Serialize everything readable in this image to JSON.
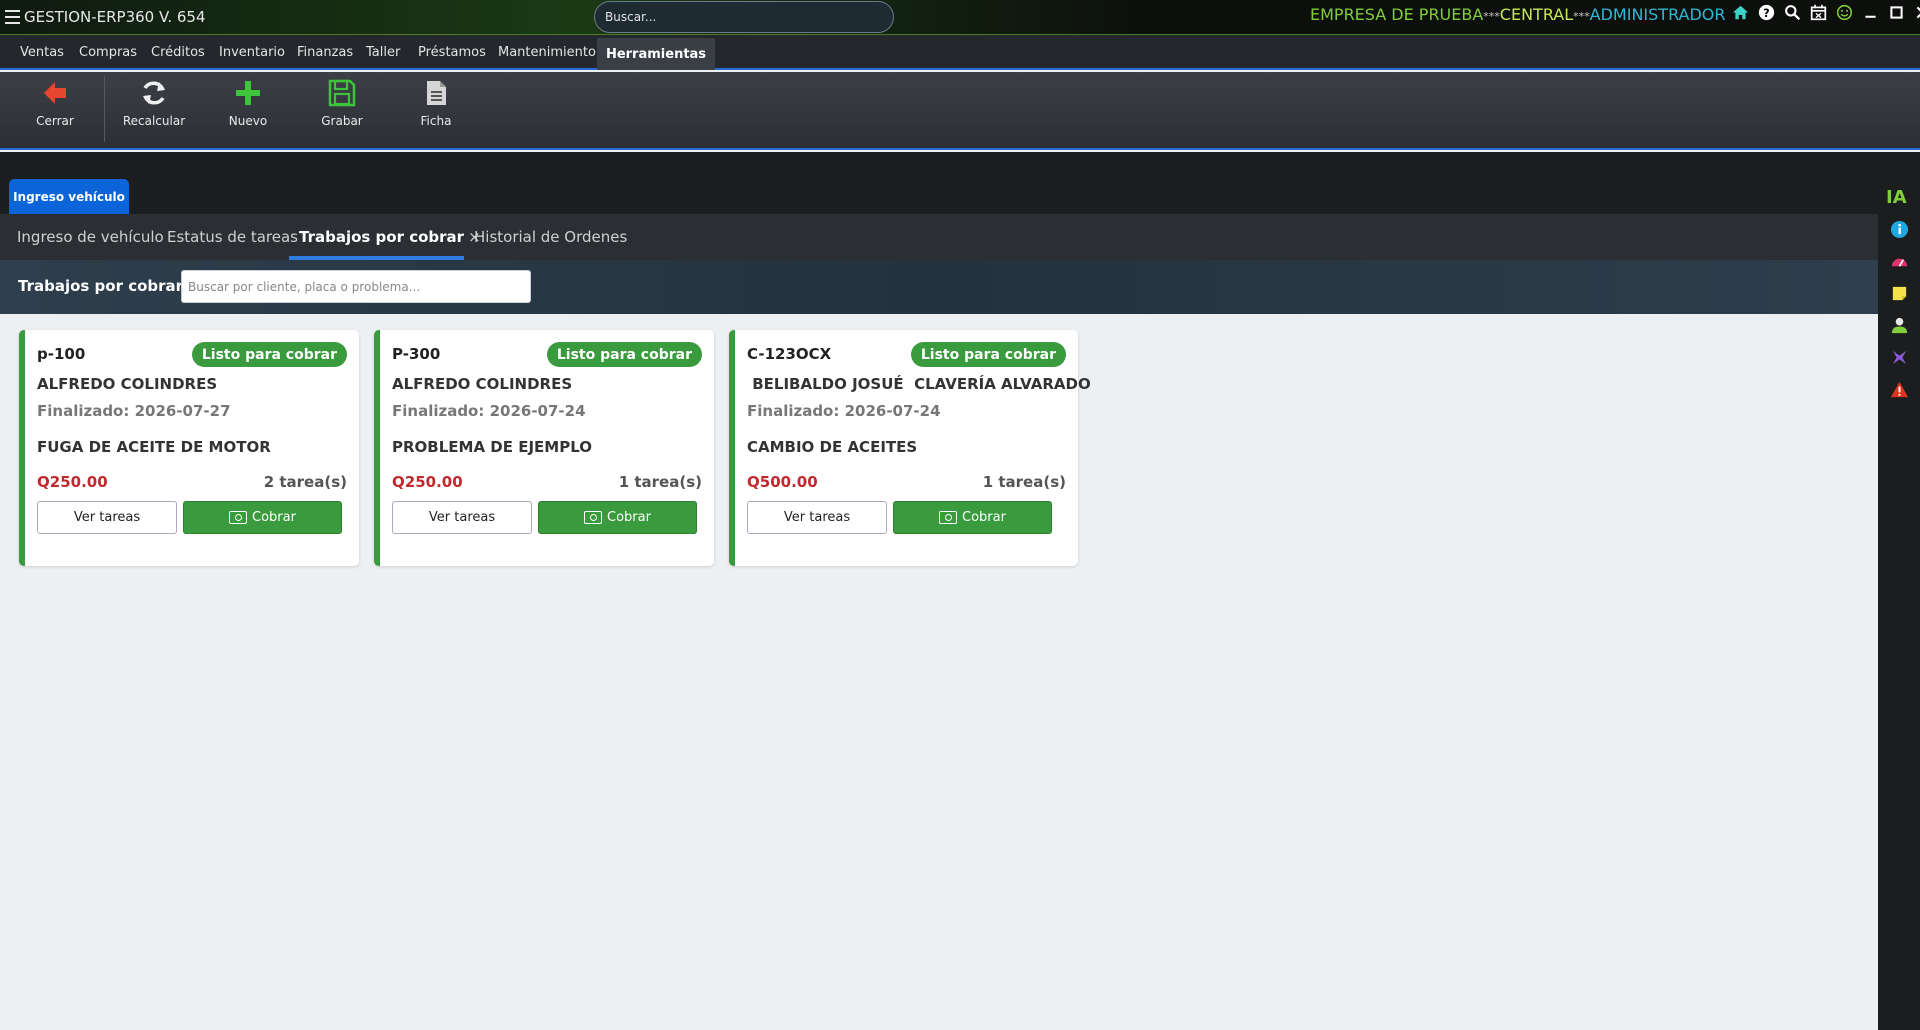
{
  "window": {
    "title": "GESTION-ERP360 V. 654",
    "search_placeholder": "Buscar...",
    "company": "EMPRESA DE PRUEBA",
    "sep": "***",
    "branch": "CENTRAL",
    "user": "ADMINISTRADOR"
  },
  "menu": {
    "items": [
      "Ventas",
      "Compras",
      "Créditos",
      "Inventario",
      "Finanzas",
      "Taller",
      "Préstamos",
      "Mantenimiento"
    ],
    "active": "Herramientas"
  },
  "toolbar": {
    "close": "Cerrar",
    "recalc": "Recalcular",
    "new": "Nuevo",
    "save": "Grabar",
    "sheet": "Ficha"
  },
  "module_tab": "Ingreso vehículo",
  "subtabs": [
    "Ingreso de vehículo",
    "Estatus de tareas",
    "Trabajos por cobrar",
    "Historial de Ordenes"
  ],
  "subtab_close": "×",
  "filter": {
    "title": "Trabajos por cobrar",
    "placeholder": "Buscar por cliente, placa o problema..."
  },
  "rail": {
    "ia": "IA"
  },
  "jobs": [
    {
      "plate": "p-100",
      "status": "Listo para cobrar",
      "client": "ALFREDO COLINDRES",
      "finished": "Finalizado: 2026-07-27",
      "problem": "FUGA DE ACEITE DE MOTOR",
      "price": "Q250.00",
      "tasks": "2 tarea(s)",
      "view_label": "Ver tareas",
      "charge_label": "Cobrar"
    },
    {
      "plate": "P-300",
      "status": "Listo para cobrar",
      "client": "ALFREDO COLINDRES",
      "finished": "Finalizado: 2026-07-24",
      "problem": "PROBLEMA DE EJEMPLO",
      "price": "Q250.00",
      "tasks": "1 tarea(s)",
      "view_label": "Ver tareas",
      "charge_label": "Cobrar"
    },
    {
      "plate": "C-123OCX",
      "status": "Listo para cobrar",
      "client": " BELIBALDO JOSUÉ  CLAVERÍA ALVARADO",
      "finished": "Finalizado: 2026-07-24",
      "problem": "CAMBIO DE ACEITES",
      "price": "Q500.00",
      "tasks": "1 tarea(s)",
      "view_label": "Ver tareas",
      "charge_label": "Cobrar"
    }
  ],
  "colors": {
    "accent_blue": "#2b6bd1",
    "success_green": "#3a9b3e",
    "price_red": "#c0292e"
  }
}
